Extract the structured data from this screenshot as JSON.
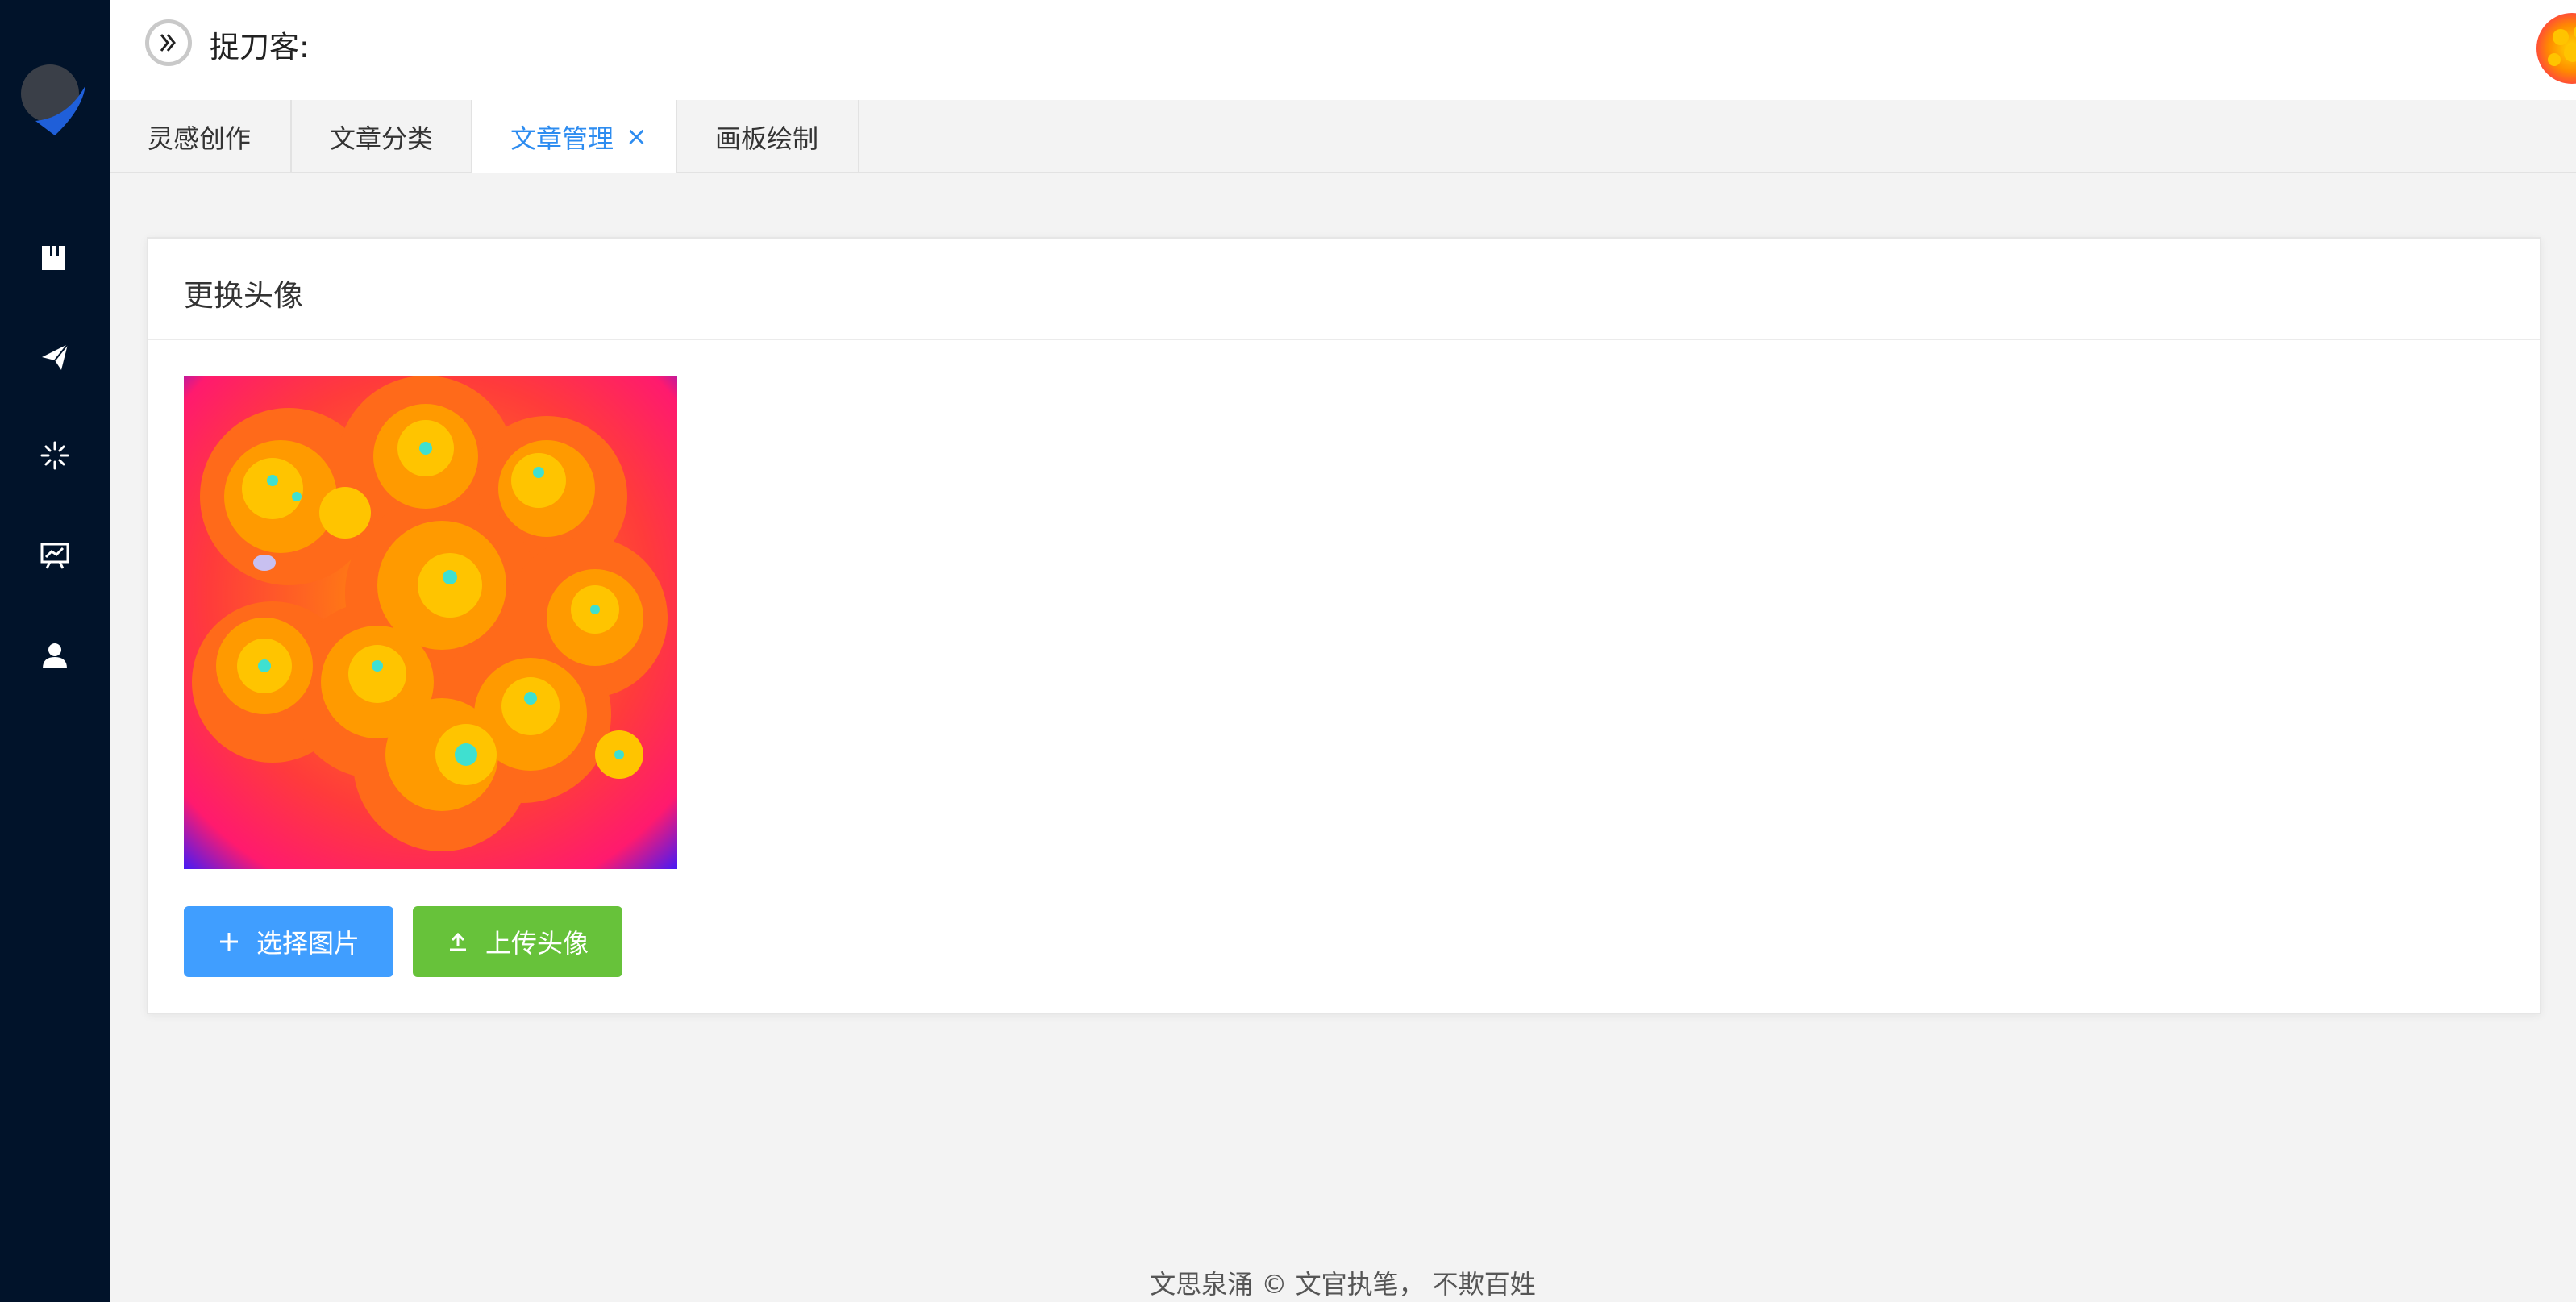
{
  "header": {
    "user_label": "捉刀客:"
  },
  "sidebar": {
    "items": [
      {
        "icon": "book-icon"
      },
      {
        "icon": "send-icon"
      },
      {
        "icon": "loading-icon"
      },
      {
        "icon": "presentation-chart-icon"
      },
      {
        "icon": "user-icon"
      }
    ]
  },
  "tabs": [
    {
      "label": "灵感创作",
      "active": false
    },
    {
      "label": "文章分类",
      "active": false
    },
    {
      "label": "文章管理",
      "active": true,
      "close": "×"
    },
    {
      "label": "画板绘制",
      "active": false
    }
  ],
  "card": {
    "title": "更换头像",
    "select_button": "选择图片",
    "upload_button": "上传头像"
  },
  "footer": {
    "text": "文思泉涌 © 文官执笔， 不欺百姓"
  },
  "colors": {
    "sidebar_bg": "#01132a",
    "active_tab": "#2d8cf0",
    "primary": "#409eff",
    "success": "#67c23a"
  }
}
